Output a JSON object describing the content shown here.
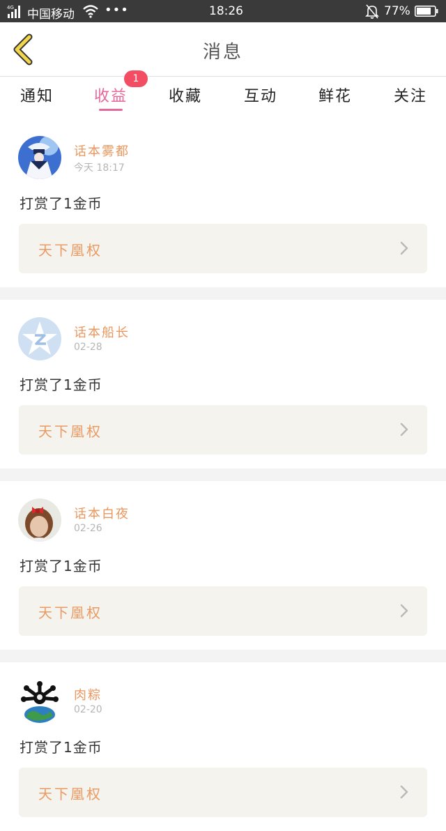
{
  "status_bar": {
    "network": "4G",
    "carrier": "中国移动",
    "dots": "•••",
    "time": "18:26",
    "battery": "77%",
    "battery_level": 0.77
  },
  "header": {
    "title": "消息",
    "back_icon": "chevron-left-icon"
  },
  "tabs": [
    {
      "label": "通知"
    },
    {
      "label": "收益",
      "active": true,
      "badge": "1"
    },
    {
      "label": "收藏"
    },
    {
      "label": "互动"
    },
    {
      "label": "鲜花"
    },
    {
      "label": "关注"
    }
  ],
  "colors": {
    "accent": "#e8679a",
    "badge": "#f24d62",
    "username": "#e9975f",
    "book": "#ea9a62",
    "book_bg": "#f4f3ee"
  },
  "feed": [
    {
      "user": "话本雾都",
      "time": "今天 18:17",
      "message": "打赏了1金币",
      "book": "天下凰权"
    },
    {
      "user": "话本船长",
      "time": "02-28",
      "message": "打赏了1金币",
      "book": "天下凰权"
    },
    {
      "user": "话本白夜",
      "time": "02-26",
      "message": "打赏了1金币",
      "book": "天下凰权"
    },
    {
      "user": "肉粽",
      "time": "02-20",
      "message": "打赏了1金币",
      "book": "天下凰权"
    }
  ]
}
